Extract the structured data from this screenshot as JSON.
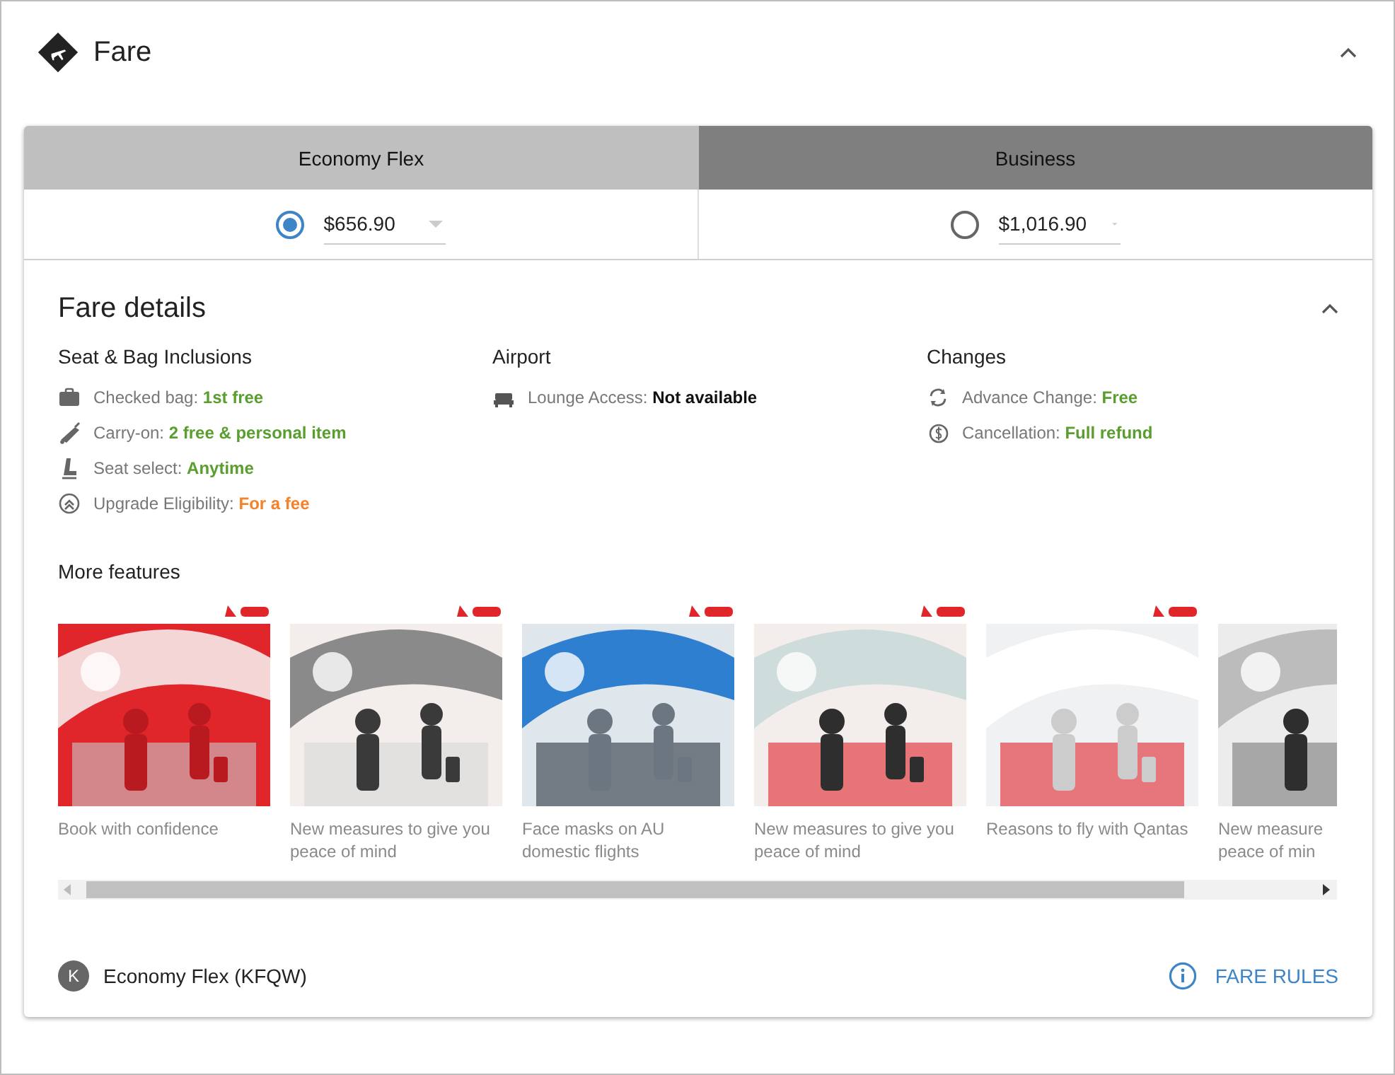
{
  "header": {
    "title": "Fare",
    "expanded": true
  },
  "fares": [
    {
      "name": "Economy Flex",
      "price": "$656.90",
      "selected": true
    },
    {
      "name": "Business",
      "price": "$1,016.90",
      "selected": false
    }
  ],
  "details": {
    "title": "Fare details",
    "expanded": true,
    "sections": [
      {
        "title": "Seat & Bag Inclusions",
        "items": [
          {
            "label": "Checked bag:",
            "value": "1st free",
            "color": "#5a9e2f"
          },
          {
            "label": "Carry-on:",
            "value": "2 free & personal item",
            "color": "#5a9e2f"
          },
          {
            "label": "Seat select:",
            "value": "Anytime",
            "color": "#5a9e2f"
          },
          {
            "label": "Upgrade Eligibility:",
            "value": "For a fee",
            "color": "#f5822a"
          }
        ]
      },
      {
        "title": "Airport",
        "items": [
          {
            "label": "Lounge Access:",
            "value": "Not available",
            "color": "#111111"
          }
        ]
      },
      {
        "title": "Changes",
        "items": [
          {
            "label": "Advance Change:",
            "value": "Free",
            "color": "#5a9e2f"
          },
          {
            "label": "Cancellation:",
            "value": "Full refund",
            "color": "#5a9e2f"
          }
        ]
      }
    ],
    "features_title": "More features",
    "features": [
      {
        "caption": "Book with confidence",
        "kind": "picture"
      },
      {
        "caption": "New measures to give you peace of mind",
        "kind": "picture"
      },
      {
        "caption": "Face masks on AU domestic flights",
        "kind": "picture"
      },
      {
        "caption": "New measures to give you peace of mind",
        "kind": "picture"
      },
      {
        "caption": "Reasons to fly with Qantas",
        "kind": "picture"
      },
      {
        "caption": "New measure\npeace of min",
        "kind": "picture"
      }
    ],
    "fare_class": {
      "badge": "K",
      "label": "Economy Flex (KFQW)"
    },
    "rules_link": "FARE RULES"
  }
}
